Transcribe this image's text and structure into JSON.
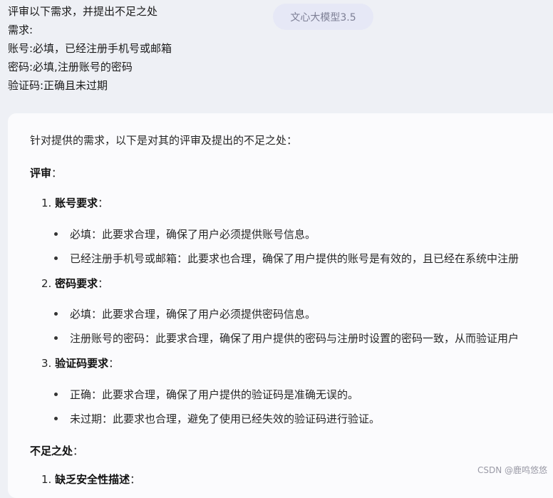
{
  "user_message": {
    "lines": [
      "评审以下需求，并提出不足之处",
      "需求:",
      "账号:必填，已经注册手机号或邮箱",
      "密码:必填,注册账号的密码",
      "验证码:正确且未过期"
    ]
  },
  "model_badge": "文心大模型3.5",
  "answer": {
    "intro": "针对提供的需求，以下是对其的评审及提出的不足之处：",
    "review_heading": "评审",
    "colon": "：",
    "items": [
      {
        "number": "1.",
        "title": "账号要求",
        "bullets": [
          "必填：此要求合理，确保了用户必须提供账号信息。",
          "已经注册手机号或邮箱：此要求也合理，确保了用户提供的账号是有效的，且已经在系统中注册"
        ]
      },
      {
        "number": "2.",
        "title": "密码要求",
        "bullets": [
          "必填：此要求合理，确保了用户必须提供密码信息。",
          "注册账号的密码：此要求合理，确保了用户提供的密码与注册时设置的密码一致，从而验证用户"
        ]
      },
      {
        "number": "3.",
        "title": "验证码要求",
        "bullets": [
          "正确：此要求合理，确保了用户提供的验证码是准确无误的。",
          "未过期：此要求也合理，避免了使用已经失效的验证码进行验证。"
        ]
      }
    ],
    "shortcomings_heading": "不足之处",
    "shortcoming_item": {
      "number": "1.",
      "title": "缺乏安全性描述"
    }
  },
  "watermark": "CSDN @鹿鸣悠悠"
}
